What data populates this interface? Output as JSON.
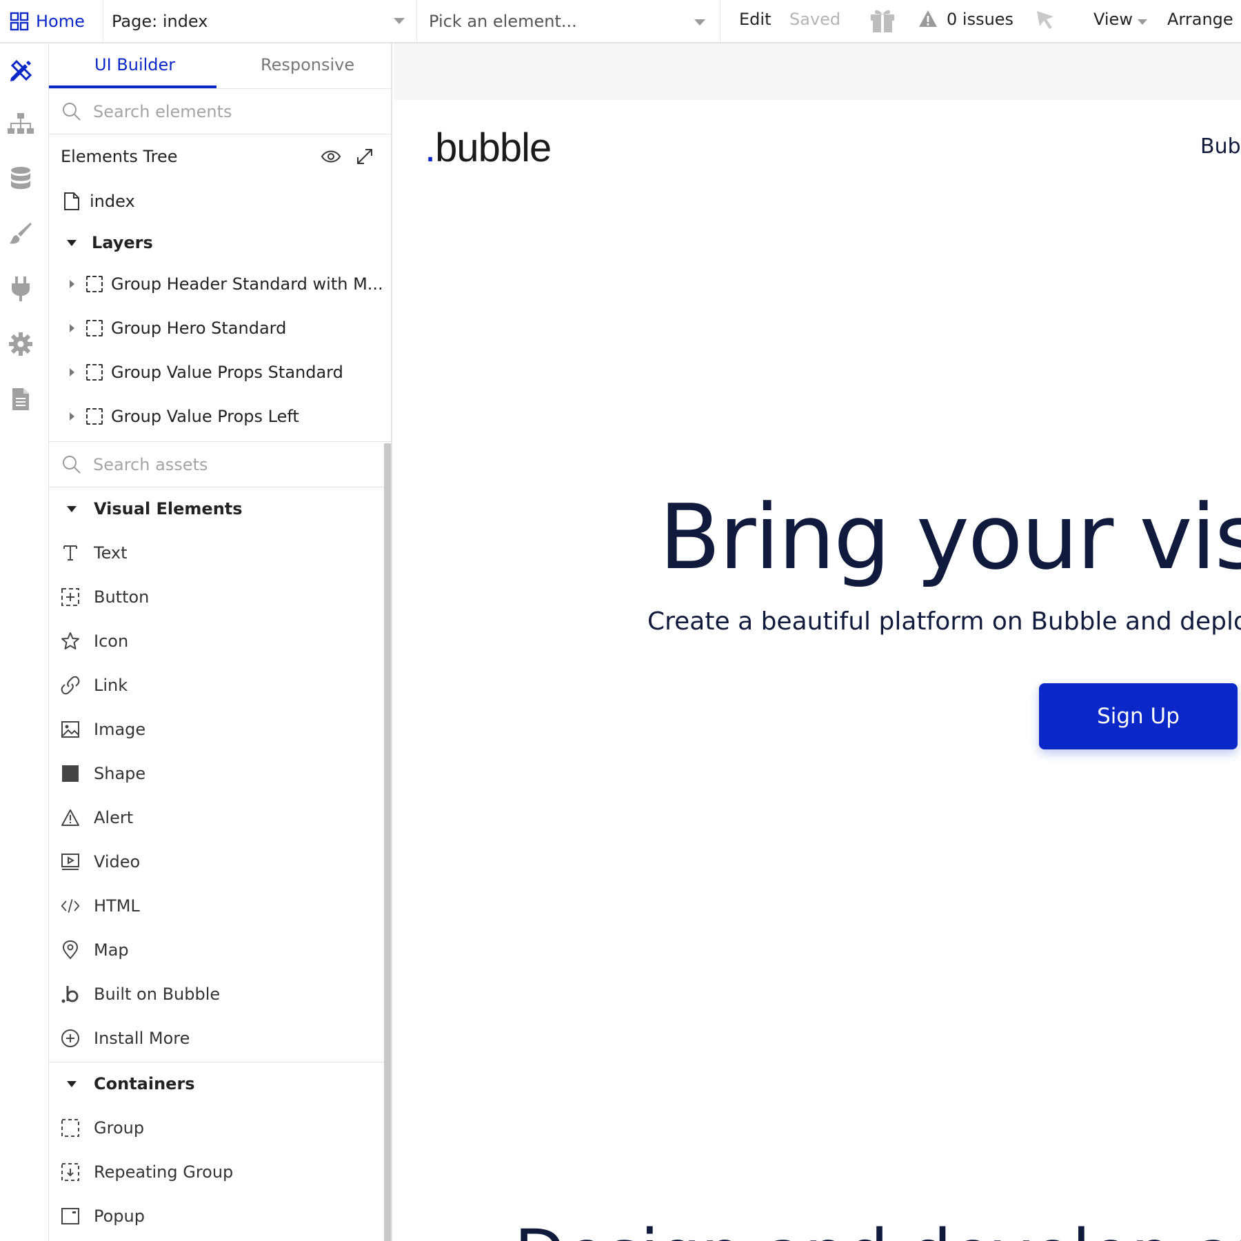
{
  "topbar": {
    "home_label": "Home",
    "page_label": "Page: index",
    "pick_placeholder": "Pick an element...",
    "edit_label": "Edit",
    "saved_label": "Saved",
    "issues_label": "0 issues",
    "view_label": "View",
    "arrange_label": "Arrange"
  },
  "rail": {
    "icons": [
      "design-icon",
      "workflow-icon",
      "data-icon",
      "styles-icon",
      "plugins-icon",
      "settings-icon",
      "logs-icon"
    ]
  },
  "panel": {
    "tabs": [
      {
        "label": "UI Builder",
        "active": true
      },
      {
        "label": "Responsive",
        "active": false
      }
    ],
    "search_elements_placeholder": "Search elements",
    "elements_tree_title": "Elements Tree",
    "tree": {
      "page": "index",
      "layers_label": "Layers",
      "groups": [
        "Group Header Standard with M...",
        "Group Hero Standard",
        "Group Value Props Standard",
        "Group Value Props Left"
      ]
    },
    "search_assets_placeholder": "Search assets",
    "visual_elements_label": "Visual Elements",
    "visual_elements": [
      {
        "label": "Text",
        "icon": "text-icon"
      },
      {
        "label": "Button",
        "icon": "button-icon"
      },
      {
        "label": "Icon",
        "icon": "star-icon"
      },
      {
        "label": "Link",
        "icon": "link-icon"
      },
      {
        "label": "Image",
        "icon": "image-icon"
      },
      {
        "label": "Shape",
        "icon": "shape-icon"
      },
      {
        "label": "Alert",
        "icon": "alert-icon"
      },
      {
        "label": "Video",
        "icon": "video-icon"
      },
      {
        "label": "HTML",
        "icon": "code-icon"
      },
      {
        "label": "Map",
        "icon": "map-pin-icon"
      },
      {
        "label": "Built on Bubble",
        "icon": "bubble-icon"
      },
      {
        "label": "Install More",
        "icon": "plus-circle-icon"
      }
    ],
    "containers_label": "Containers",
    "containers": [
      {
        "label": "Group",
        "icon": "group-icon"
      },
      {
        "label": "Repeating Group",
        "icon": "repeating-group-icon"
      },
      {
        "label": "Popup",
        "icon": "popup-icon"
      }
    ]
  },
  "canvas": {
    "logo_text": "bubble",
    "logo_dot": ".",
    "nav_text": "Bub",
    "hero_title": "Bring your visi",
    "hero_subtitle": "Create a beautiful platform on Bubble and deploy it",
    "signup_label": "Sign Up",
    "bottom_heading": "Design and develop and deplo"
  },
  "colors": {
    "accent": "#0a27c8",
    "heading": "#0f1a3d"
  }
}
